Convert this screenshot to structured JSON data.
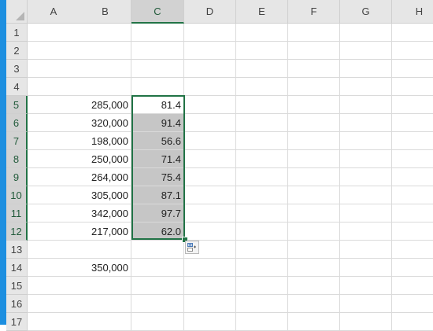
{
  "columns": [
    "A",
    "B",
    "C",
    "D",
    "E",
    "F",
    "G",
    "H"
  ],
  "selected_column": "C",
  "rows": [
    "1",
    "2",
    "3",
    "4",
    "5",
    "6",
    "7",
    "8",
    "9",
    "10",
    "11",
    "12",
    "13",
    "14",
    "15",
    "16",
    "17"
  ],
  "selected_rows": [
    "5",
    "6",
    "7",
    "8",
    "9",
    "10",
    "11",
    "12"
  ],
  "cells": {
    "B5": "285,000",
    "C5": "81.4",
    "B6": "320,000",
    "C6": "91.4",
    "B7": "198,000",
    "C7": "56.6",
    "B8": "250,000",
    "C8": "71.4",
    "B9": "264,000",
    "C9": "75.4",
    "B10": "305,000",
    "C10": "87.1",
    "B11": "342,000",
    "C11": "97.7",
    "B12": "217,000",
    "C12": "62.0",
    "B14": "350,000"
  },
  "colors": {
    "accent": "#217346",
    "selection_fill": "#c6c6c6",
    "window_edge": "#1d8fe0"
  },
  "icons": {
    "select_all": "select-all-triangle-icon",
    "quick_analysis": "quick-analysis-icon"
  }
}
